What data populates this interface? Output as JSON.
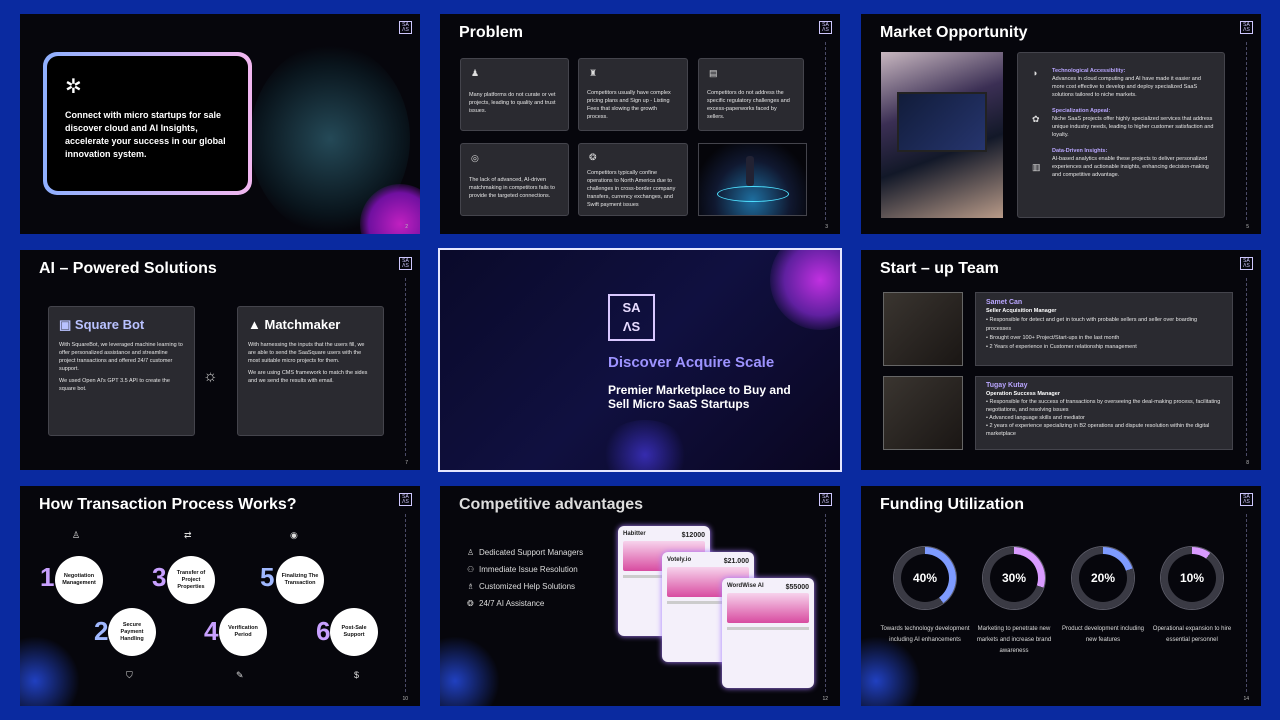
{
  "slides": {
    "s1": {
      "text": "Connect with micro startups for sale discover cloud and AI Insights, accelerate your success in our global innovation system.",
      "page": "2",
      "icon": "network-icon"
    },
    "s2": {
      "title": "Problem",
      "page": "3",
      "cards": [
        "Many platforms do not curate or vet projects, leading to quality and trust issues.",
        "Competitors usually have complex pricing plans and Sign up - Listing Fees that slowing the growth process.",
        "Competitors do not address the specific regulatory challenges and excess-paperworks faced by sellers.",
        "The lack of advanced, AI-driven matchmaking in competitors fails to provide the targeted connections.",
        "Competitors typically confine operations to North America due to challenges in cross-border company transfers, currency exchanges, and Swift payment issues"
      ]
    },
    "s3": {
      "title": "Market Opportunity",
      "page": "5",
      "items": [
        {
          "head": "Technological Accessibility:",
          "body": "Advances in cloud computing and AI have made it easier and more cost effective to develop and deploy specialized SaaS solutions tailored to niche markets."
        },
        {
          "head": "Specialization Appeal:",
          "body": "Niche SaaS projects offer highly specialized services that address unique industry needs, leading to higher customer satisfaction and loyalty."
        },
        {
          "head": "Data-Driven Insights:",
          "body": "AI-based analytics enable these projects to deliver personalized experiences and actionable insights, enhancing decision-making and competitive advantage."
        }
      ]
    },
    "s4": {
      "title": "AI – Powered Solutions",
      "page": "7",
      "bot_title": "Square Bot",
      "bot_p1": "With SquareBot, we leveraged machine learning to offer personalized assistance and streamline project transactions and offered 24/7 customer support.",
      "bot_p2": "We used Open AI's GPT 3.5 API to create the square bot.",
      "mm_title": "Matchmaker",
      "mm_p1": "With harnessing the inputs that the users fill, we are able to send the SaaSquare users with the most suitable micro projects for them.",
      "mm_p2": "We are using CMS framework to match the sides and we send the results with email."
    },
    "s5": {
      "logo_top": "SA",
      "logo_bot": "ΛS",
      "headline": "Discover Acquire Scale",
      "sub": "Premier Marketplace to Buy and Sell Micro SaaS Startups"
    },
    "s6": {
      "title": "Start – up Team",
      "page": "8",
      "members": [
        {
          "name": "Samet Can",
          "role": "Seller Acquisition Manager",
          "points": [
            "Responsible for detect and get in touch with probable sellers and seller over boarding processes",
            "Brought over 100+ Project/Start-ups in the last month",
            "2 Years of experience in Customer relationship management"
          ]
        },
        {
          "name": "Tugay Kutay",
          "role": "Operation Success Manager",
          "points": [
            "Responsible for the success of transactions by overseeing the deal-making process, facilitating negotiations, and resolving issues",
            "Advanced language skills and mediator",
            "2 years of experience specializing in B2 operations and dispute resolution within the digital marketplace"
          ]
        }
      ]
    },
    "s7": {
      "title": "How Transaction Process Works?",
      "page": "10",
      "steps": [
        {
          "n": "1",
          "label": "Negotiation Management"
        },
        {
          "n": "2",
          "label": "Secure Payment Handling"
        },
        {
          "n": "3",
          "label": "Transfer of Project Properties"
        },
        {
          "n": "4",
          "label": "Verification Period"
        },
        {
          "n": "5",
          "label": "Finalizing The Transaction"
        },
        {
          "n": "6",
          "label": "Post-Sale Support"
        }
      ]
    },
    "s8": {
      "title": "Competitive advantages",
      "page": "12",
      "items": [
        "Dedicated Support Managers",
        "Immediate Issue Resolution",
        "Customized Help Solutions",
        "24/7 AI Assistance"
      ],
      "phones": [
        {
          "name": "Habitter",
          "price": "$12000"
        },
        {
          "name": "Votely.io",
          "price": "$21.000"
        },
        {
          "name": "WordWise AI",
          "price": "$55000"
        }
      ]
    },
    "s9": {
      "title": "Funding Utilization",
      "page": "14",
      "items": [
        {
          "pct": "40%",
          "value": 40,
          "color": "#7e9bff",
          "label": "Towards technology development including AI enhancements"
        },
        {
          "pct": "30%",
          "value": 30,
          "color": "#d99bff",
          "label": "Marketing to penetrate new markets and increase brand awareness"
        },
        {
          "pct": "20%",
          "value": 20,
          "color": "#7e9bff",
          "label": "Product development including new features"
        },
        {
          "pct": "10%",
          "value": 10,
          "color": "#d99bff",
          "label": "Operational expansion to hire essential personnel"
        }
      ]
    }
  }
}
